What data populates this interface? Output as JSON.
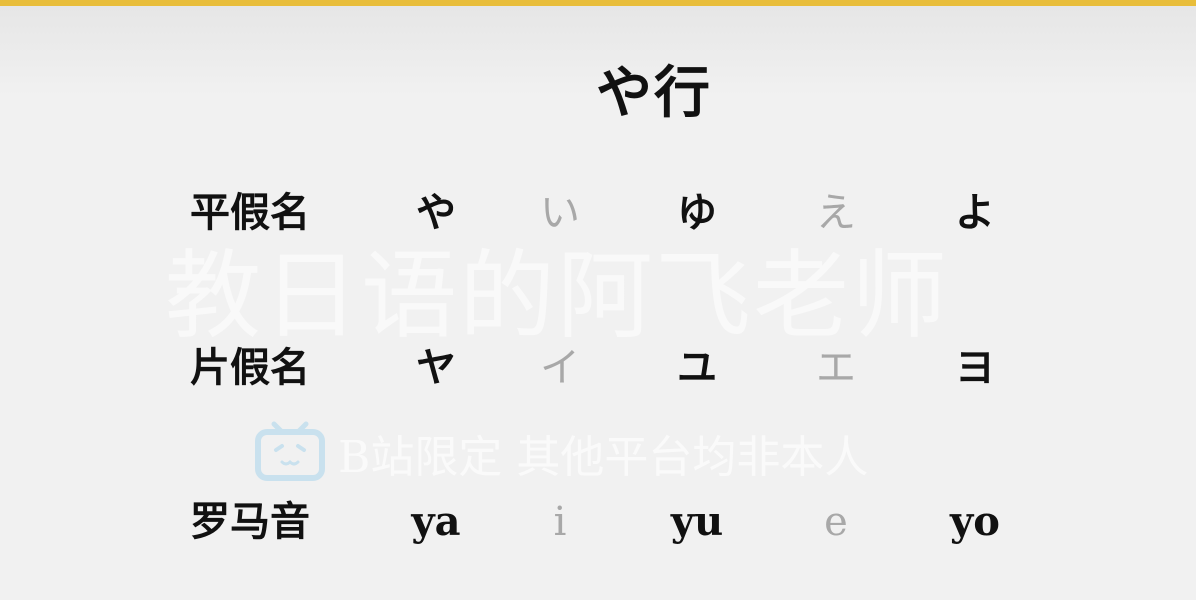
{
  "title": "や行",
  "rows": {
    "hiragana": {
      "label": "平假名",
      "cells": [
        "や",
        "い",
        "ゆ",
        "え",
        "よ"
      ]
    },
    "katakana": {
      "label": "片假名",
      "cells": [
        "ヤ",
        "イ",
        "ユ",
        "エ",
        "ヨ"
      ]
    },
    "romaji": {
      "label": "罗马音",
      "cells": [
        "ya",
        "i",
        "yu",
        "e",
        "yo"
      ]
    }
  },
  "faded_columns": [
    1,
    3
  ],
  "watermark": {
    "main": "教日语的阿飞老师",
    "sub": "B站限定 其他平台均非本人"
  },
  "colors": {
    "accent_bar": "#e8bd3a",
    "text": "#111111",
    "faded_text": "#a8a8a8",
    "background": "#f1f1f1",
    "logo": "#a9d4ec"
  },
  "icons": {
    "watermark_logo": "bilibili-tv-icon"
  }
}
